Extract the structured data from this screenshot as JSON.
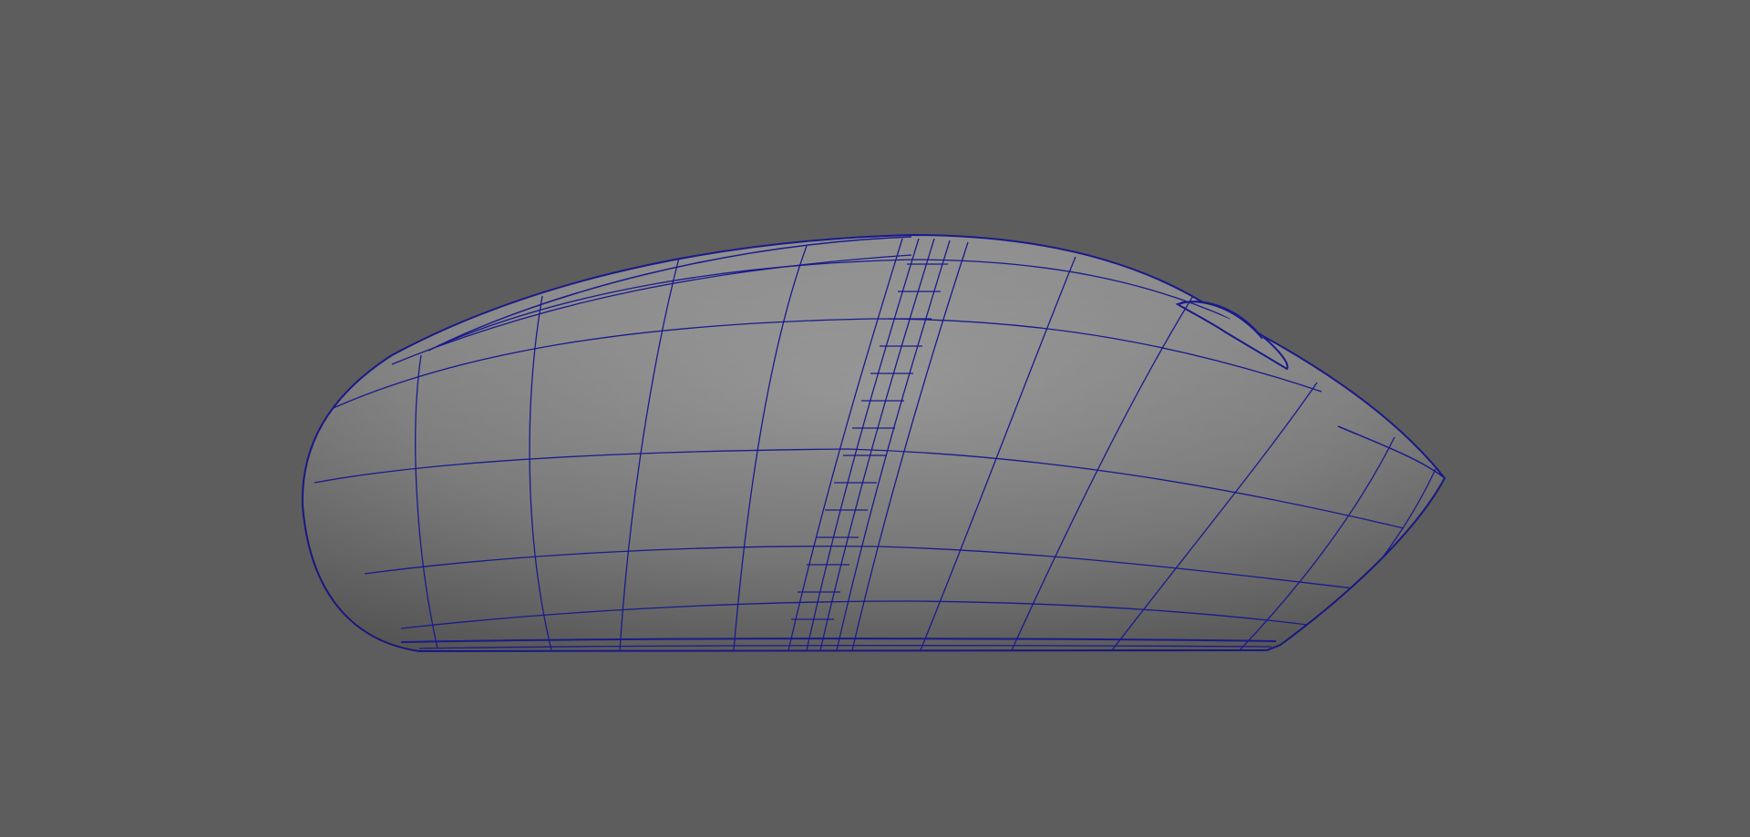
{
  "viewport": {
    "background_color": "#5d5d5d",
    "display_mode": "smooth-shaded-with-wireframe"
  },
  "model": {
    "object": "computer-mouse",
    "view": "side",
    "surface_color": "#8f8f8f",
    "wireframe_color": "#1a1a8c"
  }
}
